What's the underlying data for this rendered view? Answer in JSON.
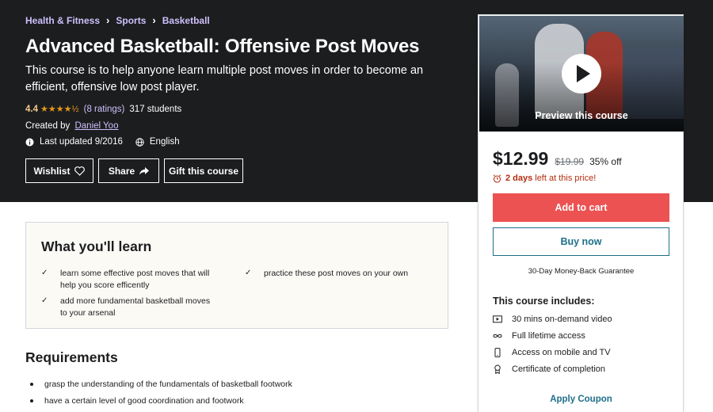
{
  "breadcrumb": [
    "Health & Fitness",
    "Sports",
    "Basketball"
  ],
  "course": {
    "title": "Advanced Basketball: Offensive Post Moves",
    "subtitle": "This course is to help anyone learn multiple post moves in order to become an efficient, offensive low post player.",
    "rating": "4.4",
    "stars": "★★★★½",
    "ratings_count": "(8 ratings)",
    "students": "317 students",
    "created_by_label": "Created by",
    "author": "Daniel Yoo",
    "last_updated": "Last updated 9/2016",
    "language": "English"
  },
  "actions": {
    "wishlist": "Wishlist",
    "share": "Share",
    "gift": "Gift this course"
  },
  "sidebar": {
    "preview_label": "Preview this course",
    "price": "$12.99",
    "original_price": "$19.99",
    "discount": "35% off",
    "timer_bold": "2 days",
    "timer_rest": "left at this price!",
    "add_to_cart": "Add to cart",
    "buy_now": "Buy now",
    "guarantee": "30-Day Money-Back Guarantee",
    "includes_title": "This course includes:",
    "includes": [
      {
        "icon": "video-icon",
        "label": "30 mins on-demand video"
      },
      {
        "icon": "infinity-icon",
        "label": "Full lifetime access"
      },
      {
        "icon": "mobile-icon",
        "label": "Access on mobile and TV"
      },
      {
        "icon": "certificate-icon",
        "label": "Certificate of completion"
      }
    ],
    "coupon": "Apply Coupon"
  },
  "learn": {
    "title": "What you'll learn",
    "items": [
      "learn some effective post moves that will help you score efficently",
      "practice these post moves on your own",
      "add more fundamental basketball moves to your arsenal"
    ]
  },
  "requirements": {
    "title": "Requirements",
    "items": [
      "grasp the understanding of the fundamentals of basketball footwork",
      "have a certain level of good coordination and footwork"
    ]
  },
  "colors": {
    "hero_bg": "#1c1d1f",
    "breadcrumb": "#cec0fc",
    "rating": "#f3ca8c",
    "cart": "#ec5252",
    "accent": "#1e6f8a",
    "timer": "#b32d0f"
  }
}
